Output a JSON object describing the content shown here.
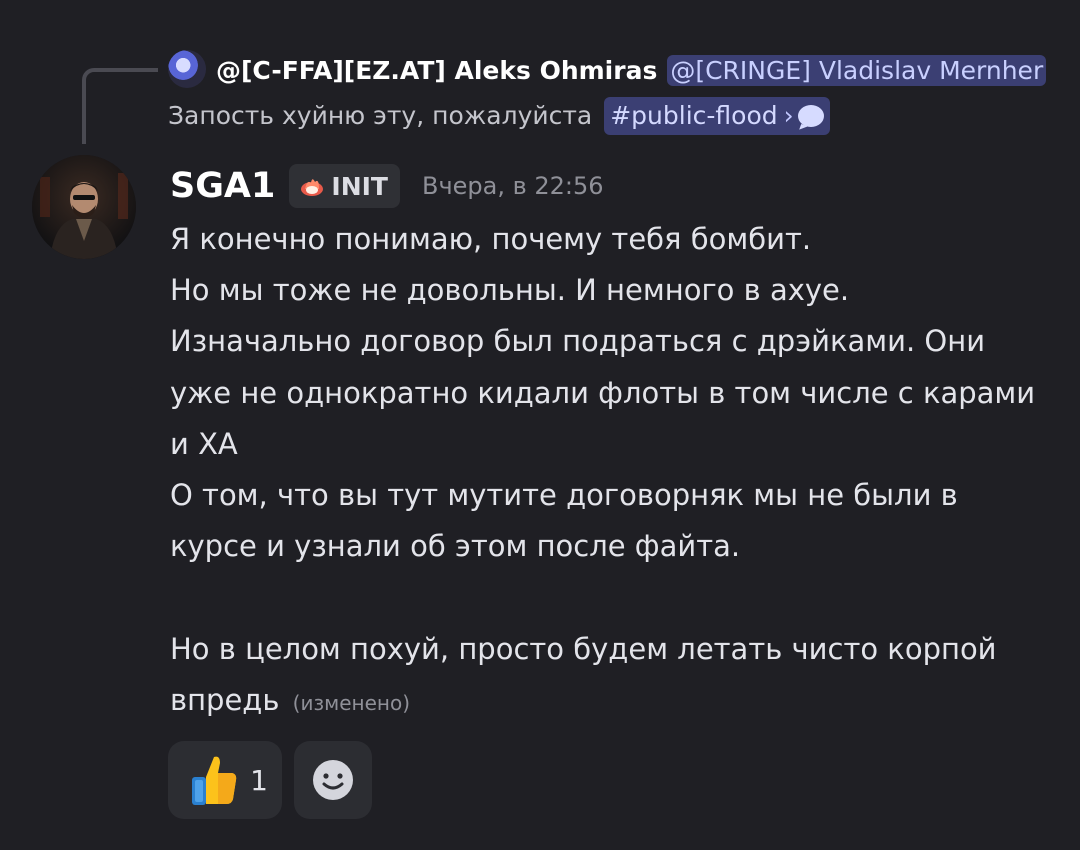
{
  "reply": {
    "author": "@[C-FFA][EZ.AT] Aleks Ohmiras",
    "mention": "@[CRINGE] Vladislav Mernher",
    "text": "Запость хуйню эту, пожалуйста",
    "channel": "#public-flood",
    "channel_arrow": "›"
  },
  "message": {
    "username": "SGA1",
    "tag": "INIT",
    "timestamp": "Вчера, в 22:56",
    "body": "Я конечно понимаю, почему тебя бомбит.\nНо мы тоже не довольны. И немного в ахуе.\nИзначально договор был подраться с дрэйками. Они уже не однократно кидали флоты в том числе с карами и ХА\nО том, что вы тут мутите договорняк мы не были в курсе и узнали об этом после файта.\n\nНо в целом похуй, просто будем летать чисто корпой впредь",
    "edited_label": "(изменено)"
  },
  "reactions": [
    {
      "emoji": "👍",
      "count": "1"
    },
    {
      "icon": "add-reaction-icon"
    }
  ],
  "colors": {
    "background": "#1f1f24",
    "mention_bg": "#3b3f73",
    "mention_text": "#c9d0ff",
    "reaction_bg": "#2c2d32"
  }
}
